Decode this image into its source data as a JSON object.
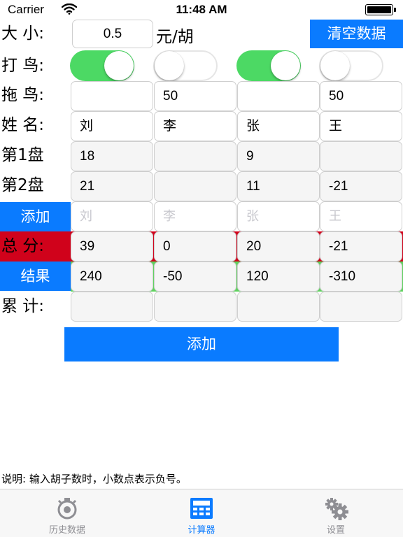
{
  "status_bar": {
    "carrier": "Carrier",
    "time": "11:48 AM"
  },
  "size_row": {
    "label": "大 小:",
    "value": "0.5",
    "unit": "元/胡",
    "clear_button": "清空数据"
  },
  "bird_row": {
    "label": "打 鸟:",
    "toggles": [
      true,
      false,
      true,
      false
    ]
  },
  "drag_row": {
    "label": "拖 鸟:",
    "values": [
      "",
      "50",
      "",
      "50"
    ]
  },
  "name_row": {
    "label": "姓 名:",
    "values": [
      "刘",
      "李",
      "张",
      "王"
    ]
  },
  "round1": {
    "label": "第1盘",
    "values": [
      "18",
      "",
      "9",
      ""
    ]
  },
  "round2": {
    "label": "第2盘",
    "values": [
      "21",
      "",
      "11",
      "-21"
    ]
  },
  "add_row": {
    "button": "添加",
    "placeholders": [
      "刘",
      "李",
      "张",
      "王"
    ]
  },
  "total_row": {
    "label": "总 分:",
    "values": [
      "39",
      "0",
      "20",
      "-21"
    ]
  },
  "result_row": {
    "button": "结果",
    "values": [
      "240",
      "-50",
      "120",
      "-310"
    ]
  },
  "cumulative_row": {
    "label": "累 计:",
    "values": [
      "",
      "",
      "",
      ""
    ]
  },
  "main_add_button": "添加",
  "note": "说明: 输入胡子数时，小数点表示负号。",
  "tabs": [
    {
      "label": "历史数据",
      "icon": "history-icon",
      "active": false
    },
    {
      "label": "计算器",
      "icon": "calculator-icon",
      "active": true
    },
    {
      "label": "设置",
      "icon": "gear-icon",
      "active": false
    }
  ],
  "colors": {
    "accent": "#0a7bff",
    "toggle_on": "#4cd964",
    "total_band": "#d0021b",
    "result_band": "#5fd15f"
  }
}
